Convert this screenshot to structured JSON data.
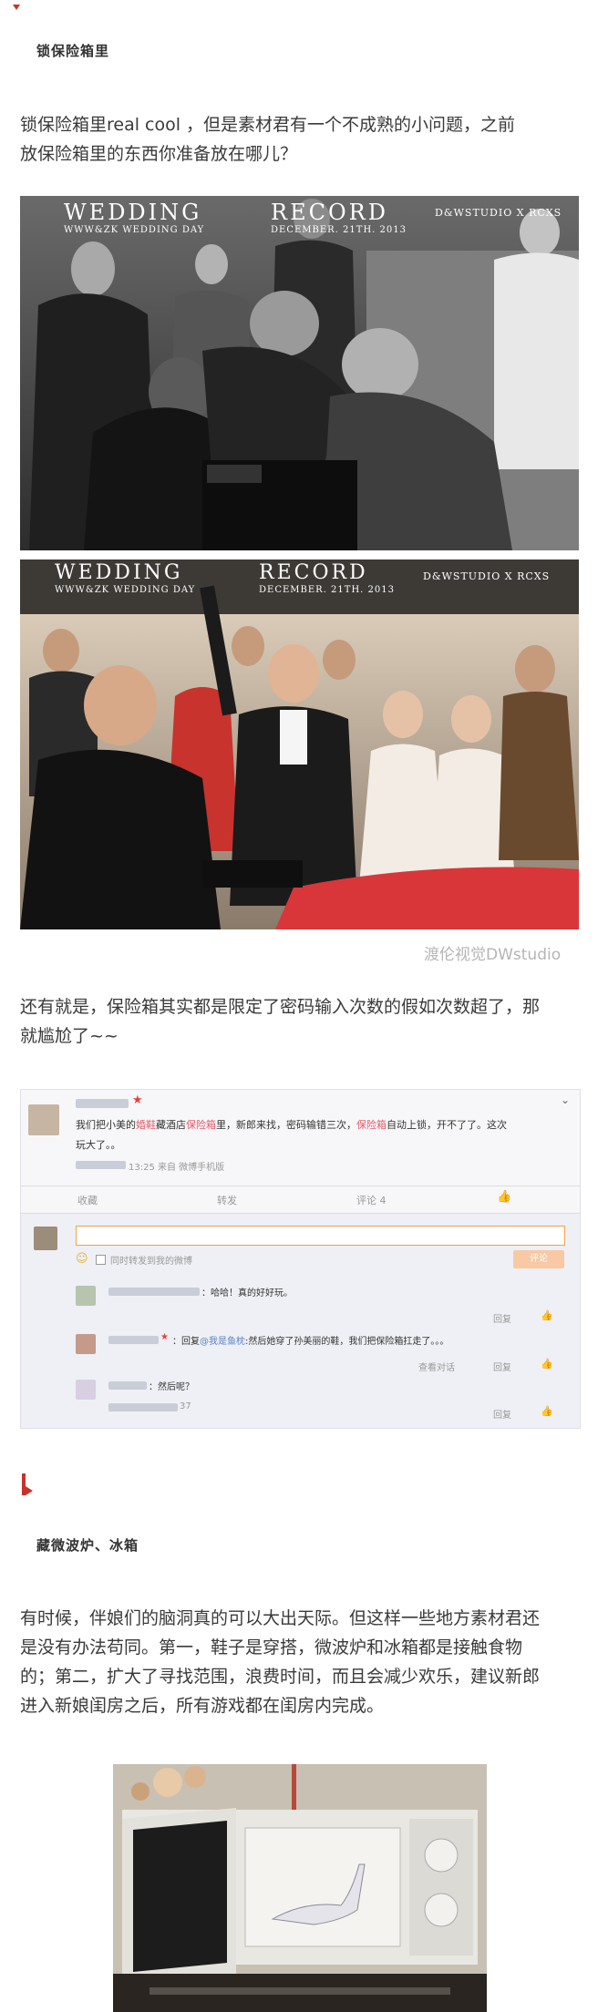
{
  "colors": {
    "accent_red": "#c8322c",
    "highlight": "#e8586a",
    "link": "#5a82c8"
  },
  "section1": {
    "heading": "锁保险箱里",
    "para_line1": "锁保险箱里real cool ，但是素材君有一个不成熟的小问题，之前",
    "para_line2": "放保险箱里的东西你准备放在哪儿？"
  },
  "photo1": {
    "title_left": "WEDDING",
    "title_right": "RECORD",
    "sub_left": "WWW&ZK WEDDING DAY",
    "sub_right": "DECEMBER. 21TH. 2013",
    "brand": "D&WSTUDIO X RCXS"
  },
  "photo2": {
    "title_left": "WEDDING",
    "title_right": "RECORD",
    "sub_left": "WWW&ZK WEDDING DAY",
    "sub_right": "DECEMBER. 21TH. 2013",
    "brand": "D&WSTUDIO X RCXS"
  },
  "caption": "渡伦视觉DWstudio",
  "section1b": {
    "para_line1": "还有就是，保险箱其实都是限定了密码输入次数的假如次数超了，那",
    "para_line2": "就尴尬了~~"
  },
  "weibo": {
    "post_a": "我们把小美的",
    "post_hl1": "婚鞋",
    "post_b": "藏酒店",
    "post_hl2": "保险箱",
    "post_c": "里，新郎来找，密码输错三次，",
    "post_hl3": "保险箱",
    "post_d": "自动上锁，开不了了。这次",
    "post_line2": "玩大了。。",
    "meta": "13:25 来自 微博手机版",
    "action_collect": "收藏",
    "action_forward": "转发",
    "action_comment": "评论 4",
    "forward_label": "同时转发到我的微博",
    "comment_btn": "评论",
    "reply1": "：哈哈！真的好好玩。",
    "reply2_a": "：回复",
    "reply2_link": "@我是鱼枕",
    "reply2_b": ":然后她穿了孙美丽的鞋，我们把保险箱扛走了。。。",
    "reply2_view": "查看对话",
    "reply3": "：然后呢？",
    "reply_time": "37",
    "reply_label": "回复"
  },
  "section2": {
    "heading": "藏微波炉、冰箱",
    "line1": "有时候，伴娘们的脑洞真的可以大出天际。但这样一些地方素材君还",
    "line2": "是没有办法苟同。第一，鞋子是穿搭，微波炉和冰箱都是接触食物",
    "line3": "的；第二，扩大了寻找范围，浪费时间，而且会减少欢乐，建议新郎",
    "line4": "进入新娘闺房之后，所有游戏都在闺房内完成。"
  }
}
